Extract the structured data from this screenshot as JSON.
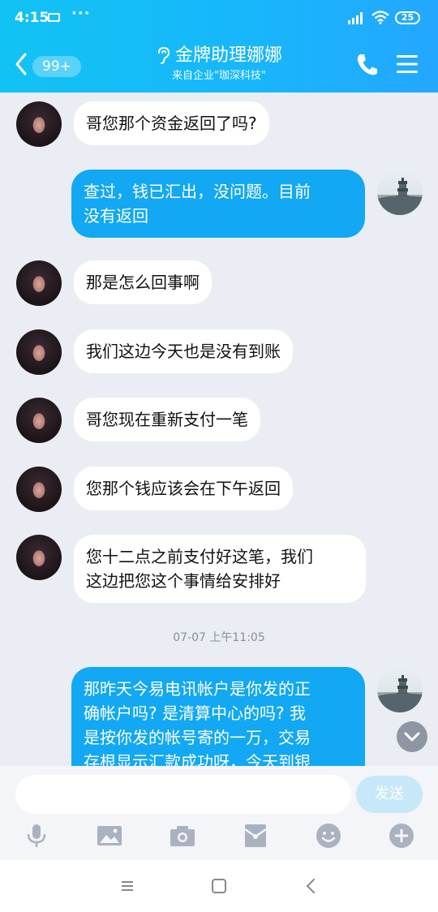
{
  "status_bar": {
    "time": "4:15",
    "dots": "···",
    "battery": "25"
  },
  "header": {
    "unread_count": "99+",
    "contact_name": "金牌助理娜娜",
    "subtitle": "来自企业\"珈深科技\""
  },
  "messages": [
    {
      "side": "left",
      "text": "哥您那个资金返回了吗?"
    },
    {
      "side": "right",
      "text": "查过，钱已汇出，没问题。目前\n没有返回"
    },
    {
      "side": "left",
      "text": "那是怎么回事啊"
    },
    {
      "side": "left",
      "text": "我们这边今天也是没有到账"
    },
    {
      "side": "left",
      "text": "哥您现在重新支付一笔"
    },
    {
      "side": "left",
      "text": "您那个钱应该会在下午返回"
    },
    {
      "side": "left",
      "text": "您十二点之前支付好这笔，我们\n这边把您这个事情给安排好"
    },
    {
      "timestamp": "07-07 上午11:05"
    },
    {
      "side": "right",
      "text": "那昨天今易电讯帐户是你发的正\n确帐户吗? 是清算中心的吗? 我\n是按你发的帐号寄的一万，交易\n存根显示汇款成功呀，今天到银"
    }
  ],
  "input": {
    "placeholder": "",
    "send_label": "发送"
  },
  "toolbar": [
    "mic-icon",
    "image-icon",
    "camera-icon",
    "red-packet-icon",
    "emoji-icon",
    "plus-icon"
  ],
  "colors": {
    "header_gradient_start": "#11c3f4",
    "header_gradient_end": "#24a7ff",
    "my_bubble": "#12a8f3",
    "their_bubble": "#ffffff",
    "chat_background": "#ebedf5",
    "send_disabled": "#c7e8f8"
  }
}
